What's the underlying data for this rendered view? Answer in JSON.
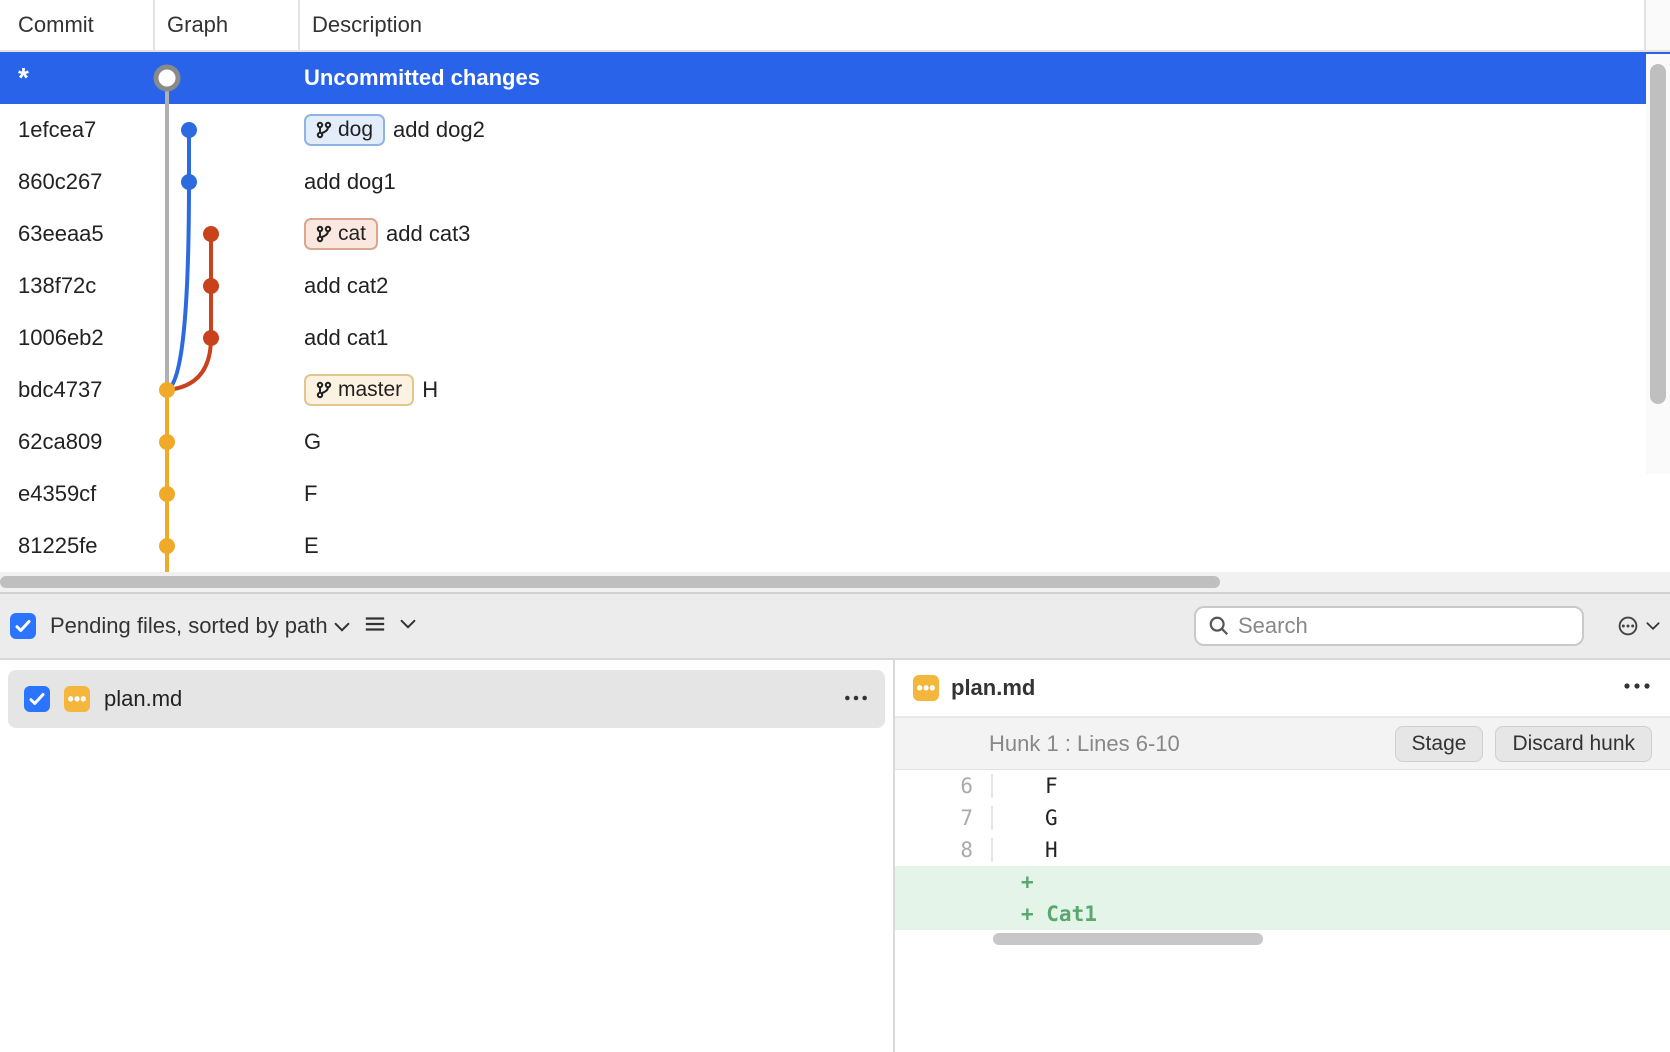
{
  "columns": {
    "commit": "Commit",
    "graph": "Graph",
    "description": "Description"
  },
  "uncommitted_label": "Uncommitted changes",
  "uncommitted_star": "*",
  "colors": {
    "dog": "#2c6ae0",
    "cat": "#c8431c",
    "master": "#f0a928",
    "head": "#9a9a9a"
  },
  "commits": [
    {
      "hash": "1efcea7",
      "branch_tag": "dog",
      "msg": "add dog2"
    },
    {
      "hash": "860c267",
      "branch_tag": null,
      "msg": "add dog1"
    },
    {
      "hash": "63eeaa5",
      "branch_tag": "cat",
      "msg": "add cat3"
    },
    {
      "hash": "138f72c",
      "branch_tag": null,
      "msg": "add cat2"
    },
    {
      "hash": "1006eb2",
      "branch_tag": null,
      "msg": "add cat1"
    },
    {
      "hash": "bdc4737",
      "branch_tag": "master",
      "msg": "H"
    },
    {
      "hash": "62ca809",
      "branch_tag": null,
      "msg": "G"
    },
    {
      "hash": "e4359cf",
      "branch_tag": null,
      "msg": "F"
    },
    {
      "hash": "81225fe",
      "branch_tag": null,
      "msg": "E"
    }
  ],
  "branch_labels": {
    "dog": "dog",
    "cat": "cat",
    "master": "master"
  },
  "pending_label": "Pending files, sorted by path",
  "search_placeholder": "Search",
  "file": {
    "name": "plan.md",
    "badge": "···"
  },
  "diff": {
    "file": "plan.md",
    "hunk_label": "Hunk 1 : Lines 6-10",
    "stage_btn": "Stage",
    "discard_btn": "Discard hunk",
    "lines": [
      {
        "num": "6",
        "text": "F",
        "added": false
      },
      {
        "num": "7",
        "text": "G",
        "added": false
      },
      {
        "num": "8",
        "text": "H",
        "added": false
      },
      {
        "num": "",
        "text": "",
        "added": true
      },
      {
        "num": "",
        "text": "Cat1",
        "added": true
      }
    ]
  }
}
